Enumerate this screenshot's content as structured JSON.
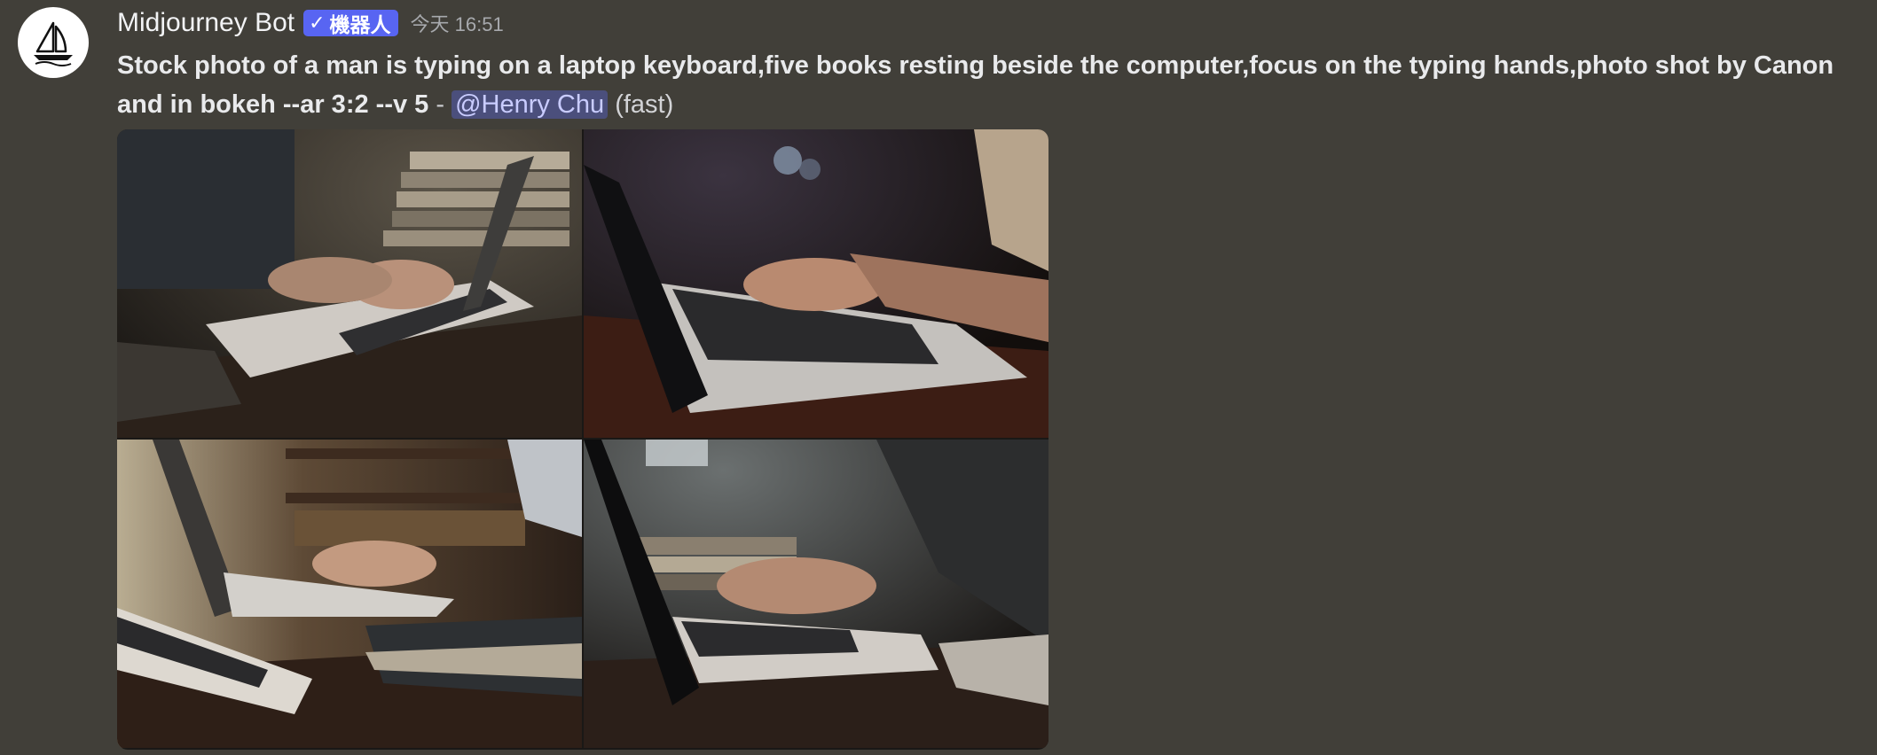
{
  "message": {
    "author": {
      "name": "Midjourney Bot",
      "badge_label": "機器人",
      "badge_check": "✓",
      "avatar_icon": "midjourney-sailboat-icon"
    },
    "timestamp": "今天 16:51",
    "prompt_text": "Stock photo of a man is typing on a laptop keyboard,five books resting beside the computer,focus on the typing hands,photo shot by Canon and in bokeh --ar 3:2 --v 5",
    "separator": " - ",
    "mention": "@Henry Chu",
    "mode": " (fast)",
    "colors": {
      "background": "#413f39",
      "badge": "#5865f2",
      "mention_bg": "#4b4f7c",
      "mention_text": "#c9ccff"
    }
  },
  "image_grid": {
    "layout": "2x2",
    "images": [
      {
        "subject": "hands typing on laptop with stacked books, top-left"
      },
      {
        "subject": "hands typing on laptop on wooden desk, top-right"
      },
      {
        "subject": "hands typing on laptop beside bookshelf, bottom-left"
      },
      {
        "subject": "hands typing on laptop with books in background, bottom-right"
      }
    ]
  }
}
